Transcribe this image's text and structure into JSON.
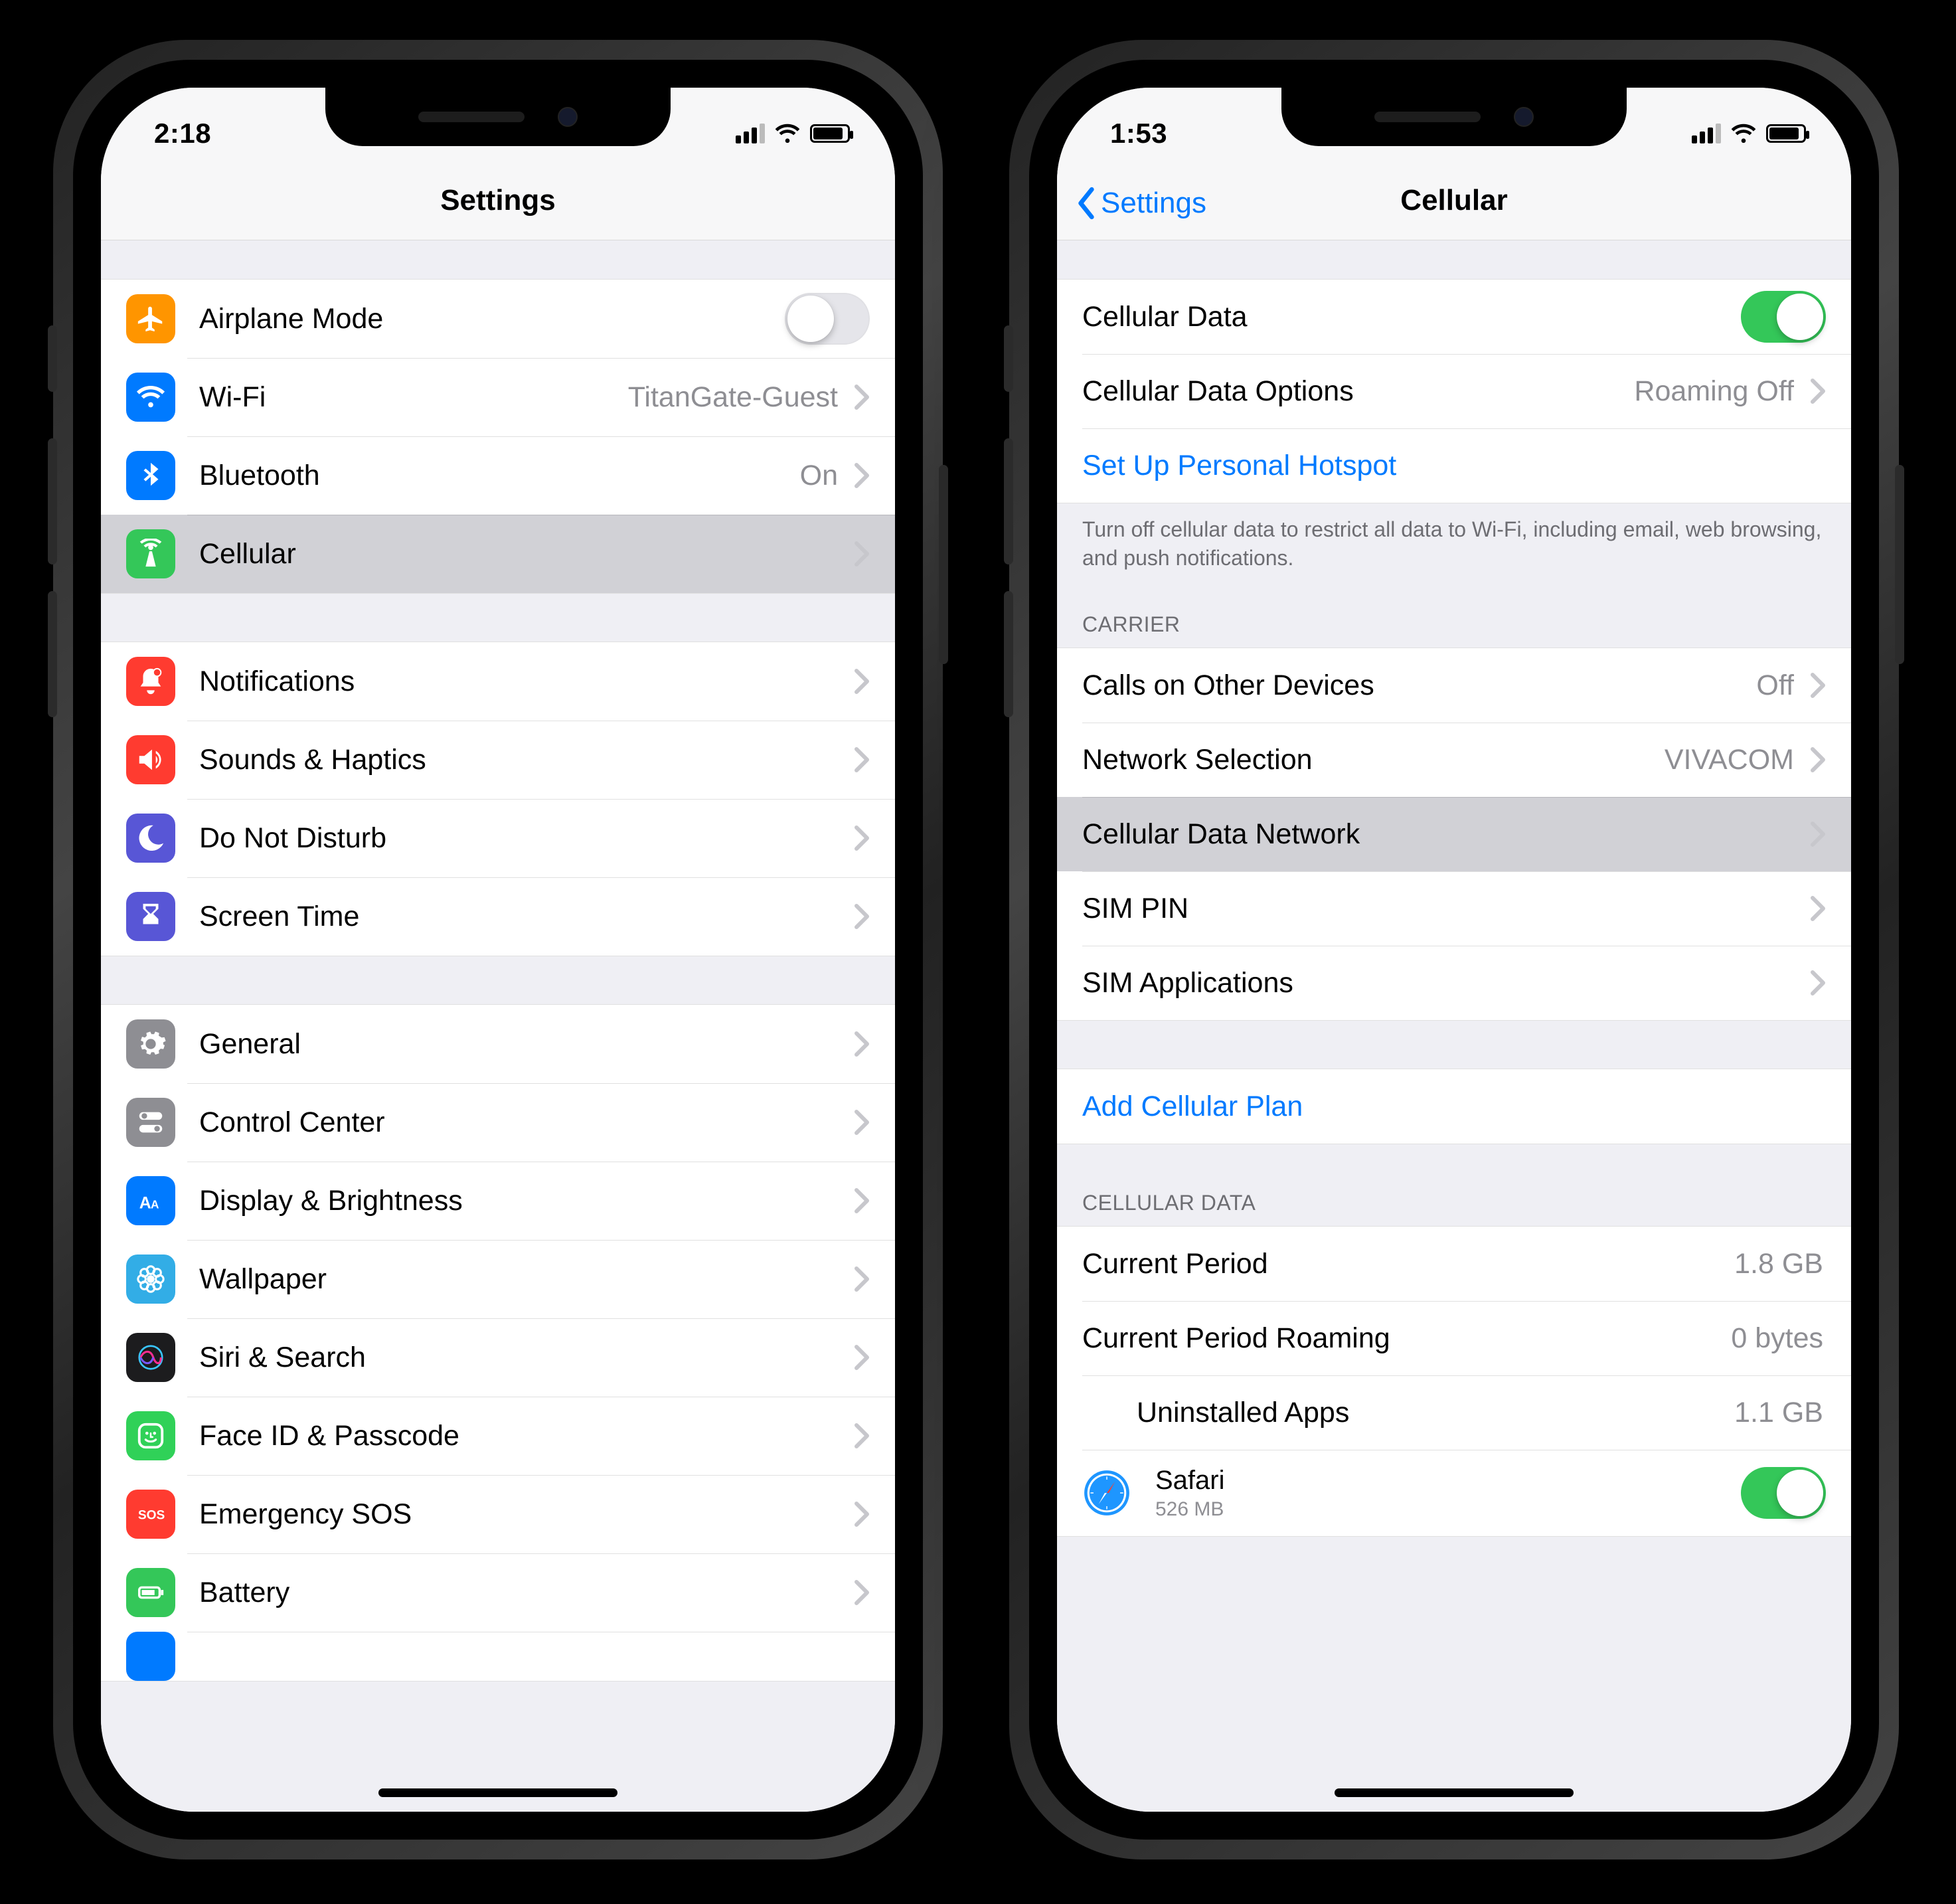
{
  "left": {
    "status": {
      "time": "2:18"
    },
    "nav": {
      "title": "Settings"
    },
    "groups": {
      "g1": {
        "airplane": {
          "label": "Airplane Mode",
          "on": false
        },
        "wifi": {
          "label": "Wi-Fi",
          "value": "TitanGate-Guest"
        },
        "bluetooth": {
          "label": "Bluetooth",
          "value": "On"
        },
        "cellular": {
          "label": "Cellular"
        }
      },
      "g2": {
        "notifications": {
          "label": "Notifications"
        },
        "sounds": {
          "label": "Sounds & Haptics"
        },
        "dnd": {
          "label": "Do Not Disturb"
        },
        "screentime": {
          "label": "Screen Time"
        }
      },
      "g3": {
        "general": {
          "label": "General"
        },
        "control": {
          "label": "Control Center"
        },
        "display": {
          "label": "Display & Brightness"
        },
        "wallpaper": {
          "label": "Wallpaper"
        },
        "siri": {
          "label": "Siri & Search"
        },
        "faceid": {
          "label": "Face ID & Passcode"
        },
        "sos": {
          "label": "Emergency SOS"
        },
        "battery": {
          "label": "Battery"
        }
      }
    }
  },
  "right": {
    "status": {
      "time": "1:53"
    },
    "nav": {
      "back": "Settings",
      "title": "Cellular"
    },
    "g1": {
      "cellulardata": {
        "label": "Cellular Data",
        "on": true
      },
      "options": {
        "label": "Cellular Data Options",
        "value": "Roaming Off"
      },
      "hotspot": {
        "label": "Set Up Personal Hotspot"
      },
      "footer": "Turn off cellular data to restrict all data to Wi-Fi, including email, web browsing, and push notifications."
    },
    "carrier": {
      "header": "CARRIER",
      "calls": {
        "label": "Calls on Other Devices",
        "value": "Off"
      },
      "network": {
        "label": "Network Selection",
        "value": "VIVACOM"
      },
      "datanetwork": {
        "label": "Cellular Data Network"
      },
      "simpin": {
        "label": "SIM PIN"
      },
      "simapps": {
        "label": "SIM Applications"
      }
    },
    "plan": {
      "addplan": "Add Cellular Plan"
    },
    "usage": {
      "header": "CELLULAR DATA",
      "period": {
        "label": "Current Period",
        "value": "1.8 GB"
      },
      "roaming": {
        "label": "Current Period Roaming",
        "value": "0 bytes"
      },
      "uninstalled": {
        "label": "Uninstalled Apps",
        "value": "1.1 GB"
      },
      "safari": {
        "label": "Safari",
        "sub": "526 MB",
        "on": true
      }
    }
  }
}
